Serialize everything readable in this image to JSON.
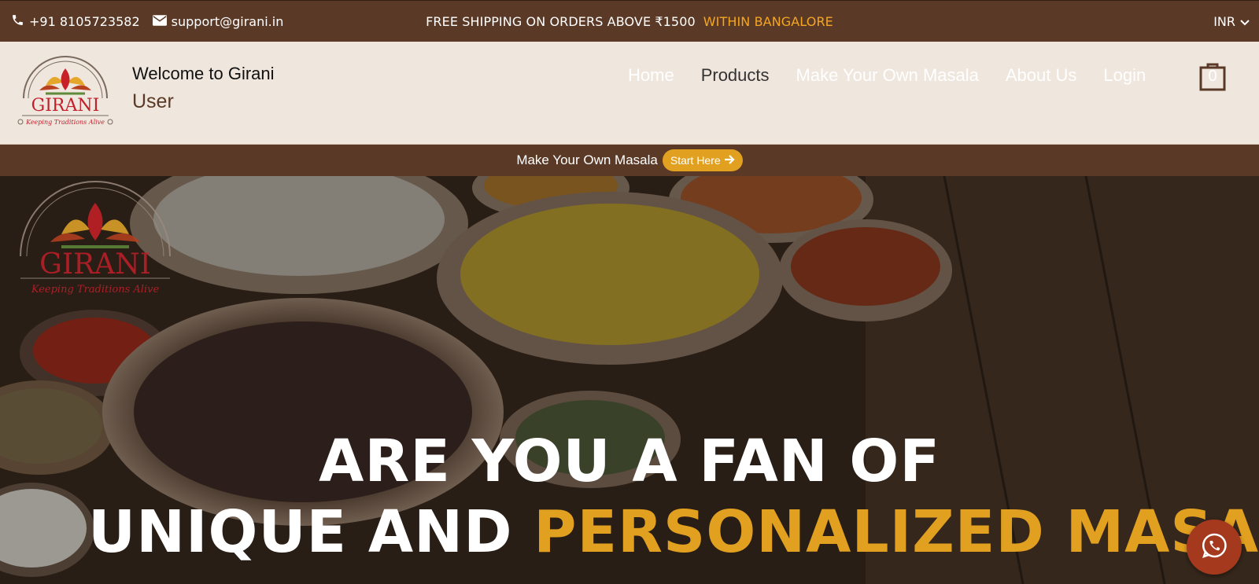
{
  "topbar": {
    "phone": "+91 8105723582",
    "email": "support@girani.in",
    "promo_text": "FREE SHIPPING ON ORDERS ABOVE ₹1500",
    "promo_highlight": "WITHIN BANGALORE",
    "currency": "INR"
  },
  "header": {
    "logo_text": "GIRANI",
    "logo_tagline": "Keeping Traditions Alive",
    "welcome_line": "Welcome to Girani",
    "user_label": "User",
    "nav": [
      {
        "label": "Home"
      },
      {
        "label": "Products"
      },
      {
        "label": "Make Your Own Masala"
      },
      {
        "label": "About Us"
      },
      {
        "label": "Login"
      }
    ],
    "cart_count": "0"
  },
  "make_own_bar": {
    "label": "Make Your Own Masala",
    "button_label": "Start Here"
  },
  "hero": {
    "logo_text": "GIRANI",
    "logo_tagline": "Keeping Traditions Alive",
    "headline_line1": "ARE YOU A FAN OF",
    "headline_line2_plain": "UNIQUE AND",
    "headline_line2_highlight": "PERSONALIZED MASALA"
  },
  "colors": {
    "brown": "#5a3a26",
    "header_bg": "#efe6dd",
    "accent": "#e2a020",
    "whatsapp_bg": "#a4391e"
  },
  "icons": [
    "phone-icon",
    "envelope-icon",
    "chevron-down-icon",
    "cart-icon",
    "arrow-right-icon",
    "whatsapp-icon"
  ]
}
